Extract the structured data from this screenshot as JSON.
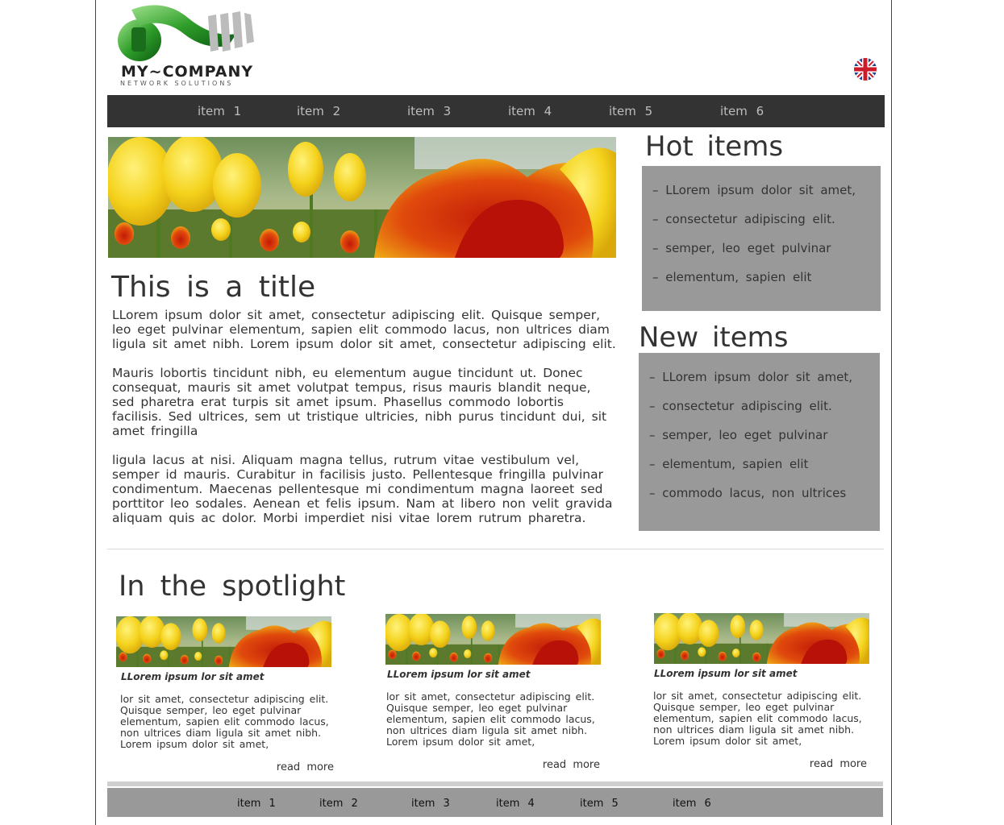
{
  "brand": {
    "name": "MY~COMPANY",
    "tagline": "NETWORK SOLUTIONS"
  },
  "language": {
    "icon": "uk-flag-icon"
  },
  "nav": {
    "items": [
      "item 1",
      "item 2",
      "item 3",
      "item 4",
      "item 5",
      "item 6"
    ]
  },
  "article": {
    "title": "This is a title",
    "paragraphs": [
      "LLorem ipsum dolor sit amet, consectetur adipiscing elit. Quisque semper, leo eget pulvinar elementum, sapien elit commodo lacus, non ultrices diam ligula sit amet nibh. Lorem ipsum dolor sit amet, consectetur adipiscing elit.",
      "Mauris lobortis tincidunt nibh, eu elementum augue tincidunt ut. Donec consequat, mauris sit amet volutpat tempus, risus mauris blandit neque, sed pharetra erat turpis sit amet ipsum. Phasellus commodo lobortis facilisis. Sed ultrices, sem ut tristique ultricies, nibh purus tincidunt dui, sit amet fringilla",
      "ligula lacus at nisi. Aliquam magna tellus, rutrum vitae vestibulum vel, semper id mauris. Curabitur in facilisis justo. Pellentesque fringilla pulvinar condimentum. Maecenas pellentesque mi condimentum magna laoreet sed porttitor leo sodales. Aenean et felis ipsum. Nam at libero non velit gravida aliquam quis ac dolor. Morbi imperdiet nisi vitae lorem rutrum pharetra."
    ]
  },
  "hot_items": {
    "title": "Hot items",
    "items": [
      "– LLorem ipsum dolor sit amet,",
      "– consectetur adipiscing elit.",
      "– semper, leo eget pulvinar",
      "– elementum, sapien elit"
    ]
  },
  "new_items": {
    "title": "New items",
    "items": [
      "– LLorem ipsum dolor sit amet,",
      "– consectetur adipiscing elit.",
      "– semper, leo eget pulvinar",
      "– elementum, sapien elit",
      "– commodo lacus, non ultrices"
    ]
  },
  "spotlight": {
    "title": "In the spotlight",
    "cards": [
      {
        "title": "LLorem ipsum lor sit amet",
        "body": "lor sit amet, consectetur adipiscing elit. Quisque semper, leo eget pulvinar elementum, sapien elit commodo lacus, non ultrices diam ligula sit amet nibh. Lorem ipsum dolor sit amet,",
        "link": "read more"
      },
      {
        "title": "LLorem ipsum lor sit amet",
        "body": "lor sit amet, consectetur adipiscing elit. Quisque semper, leo eget pulvinar elementum, sapien elit commodo lacus, non ultrices diam ligula sit amet nibh. Lorem ipsum dolor sit amet,",
        "link": "read more"
      },
      {
        "title": "LLorem ipsum lor sit amet",
        "body": "lor sit amet, consectetur adipiscing elit. Quisque semper, leo eget pulvinar elementum, sapien elit commodo lacus, non ultrices diam ligula sit amet nibh. Lorem ipsum dolor sit amet,",
        "link": "read more"
      }
    ]
  },
  "footer_nav": {
    "items": [
      "item 1",
      "item 2",
      "item 3",
      "item 4",
      "item 5",
      "item 6"
    ]
  },
  "colors": {
    "nav_bg": "#333333",
    "nav_text": "#bdbdbd",
    "box_bg": "#999999",
    "footer_bg": "#999999"
  }
}
